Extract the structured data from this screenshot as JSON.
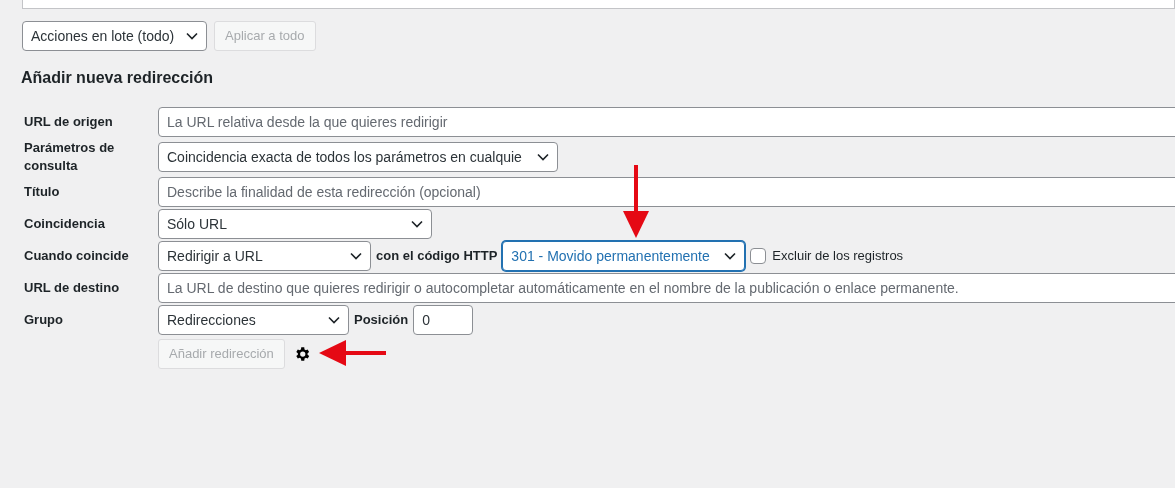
{
  "bulk_actions": {
    "select": "Acciones en lote (todo)",
    "apply_button": {
      "label": "Aplicar a todo",
      "disabled": true
    }
  },
  "heading": "Añadir nueva redirección",
  "rows": [
    {
      "label": "URL de origen",
      "fields": [
        {
          "kind": "text",
          "placeholder": "La URL relativa desde la que quieres redirigir"
        }
      ]
    },
    {
      "label": "Parámetros de consulta",
      "fields": [
        {
          "kind": "select",
          "value": "Coincidencia exacta de todos los parámetros en cualquie",
          "focused": false
        }
      ]
    },
    {
      "label": "Título",
      "fields": [
        {
          "kind": "text",
          "placeholder": "Describe la finalidad de esta redirección (opcional)"
        }
      ]
    },
    {
      "label": "Coincidencia",
      "fields": [
        {
          "kind": "select",
          "value": "Sólo URL",
          "focused": false
        }
      ]
    },
    {
      "label": "Cuando coincide",
      "fields": [
        {
          "kind": "select",
          "value": "Redirigir a URL",
          "focused": false
        },
        {
          "kind": "label",
          "text": "con el código HTTP"
        },
        {
          "kind": "select",
          "value": "301 - Movido permanentemente",
          "focused": true
        },
        {
          "kind": "checkbox",
          "text": "Excluir de los registros",
          "checked": false
        }
      ]
    },
    {
      "label": "URL de destino",
      "fields": [
        {
          "kind": "text",
          "placeholder": "La URL de destino que quieres redirigir o autocompletar automáticamente en el nombre de la publicación o enlace permanente."
        }
      ]
    },
    {
      "label": "Grupo",
      "fields": [
        {
          "kind": "select",
          "value": "Redirecciones",
          "focused": false
        },
        {
          "kind": "label",
          "text": "Posición"
        },
        {
          "kind": "number",
          "value": "0"
        }
      ]
    }
  ],
  "add_button": {
    "label": "Añadir redirección",
    "disabled": true
  }
}
